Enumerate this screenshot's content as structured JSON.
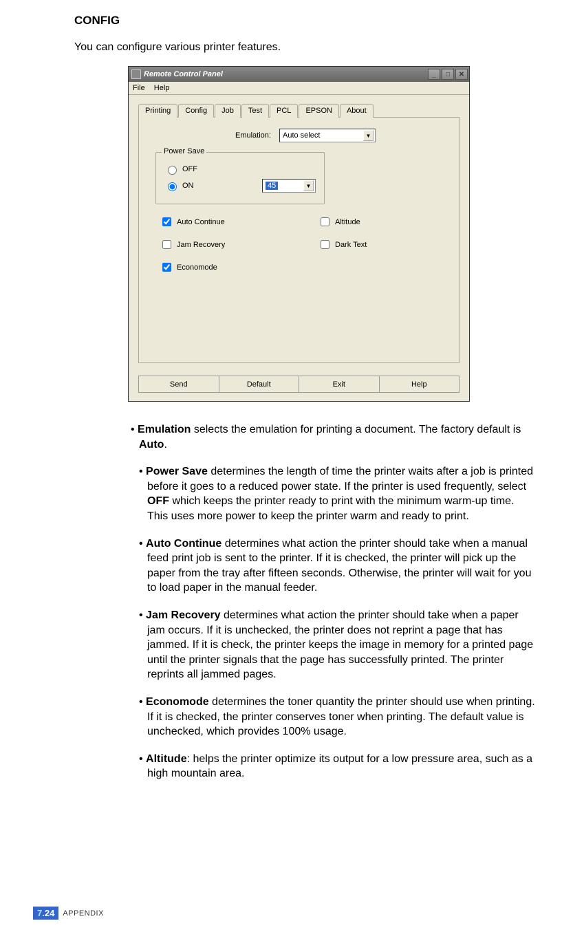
{
  "heading": "CONFIG",
  "intro": "You can configure various printer features.",
  "window": {
    "title": "Remote Control Panel",
    "menu": {
      "file": "File",
      "help": "Help"
    },
    "tabs": [
      "Printing",
      "Config",
      "Job",
      "Test",
      "PCL",
      "EPSON",
      "About"
    ],
    "active_tab": "Config",
    "emulation": {
      "label": "Emulation:",
      "value": "Auto select"
    },
    "power_save": {
      "label": "Power Save",
      "off_label": "OFF",
      "on_label": "ON",
      "value": "45"
    },
    "checks": {
      "auto_continue": "Auto Continue",
      "altitude": "Altitude",
      "jam_recovery": "Jam Recovery",
      "dark_text": "Dark Text",
      "economode": "Economode"
    },
    "buttons": {
      "send": "Send",
      "default": "Default",
      "exit": "Exit",
      "help": "Help"
    }
  },
  "bullets": [
    {
      "term": "Emulation",
      "before": " selects the emulation for printing a document. The factory default is ",
      "bold_extra": "Auto",
      "after": ".",
      "indent": false
    },
    {
      "term": "Power Save",
      "text": " determines the length of time the printer waits after a job is printed before it goes to a reduced power state. If the printer is used frequently, select ",
      "bold_mid": "OFF",
      "text2": " which keeps the printer ready to print with the minimum warm-up time. This uses more power to keep the printer warm and ready to print."
    },
    {
      "term": "Auto Continue",
      "text": " determines what action the printer should take when a manual feed print job is sent to the printer. If it is checked, the printer will pick up the paper from the tray after fifteen seconds. Otherwise, the printer will wait for you to load paper in the manual feeder."
    },
    {
      "term": "Jam Recovery",
      "text": " determines what action the printer should take when a paper jam occurs. If it is unchecked, the printer does not reprint a page that has jammed. If it is check, the printer keeps the image in memory for a printed page until the printer signals that the page has successfully printed. The printer reprints all jammed pages."
    },
    {
      "term": "Economode",
      "text": " determines the toner quantity the printer should use when printing. If it is checked, the printer conserves toner when printing. The default value is unchecked, which provides 100% usage."
    },
    {
      "term": "Altitude",
      "text": ": helps the printer optimize its output for a low pressure area, such as a high mountain area."
    }
  ],
  "footer": {
    "chapter": "7.",
    "page": "24",
    "label": "APPENDIX"
  }
}
